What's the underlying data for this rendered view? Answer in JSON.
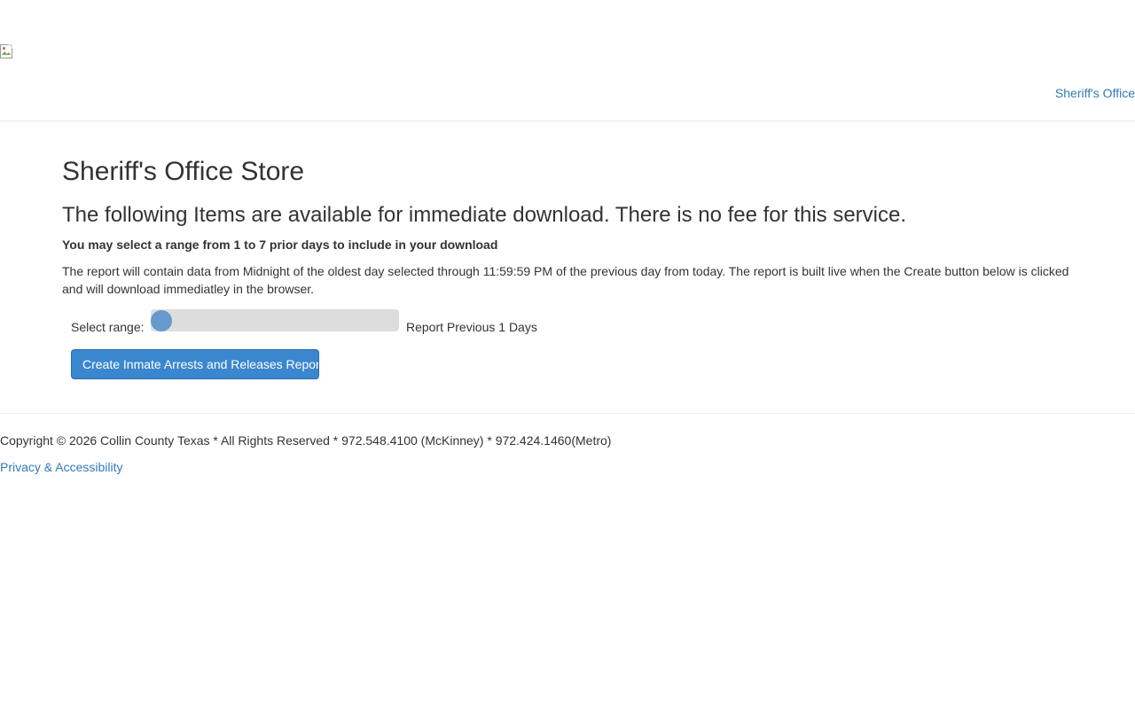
{
  "header": {
    "nav_link": "Sheriff's Office"
  },
  "main": {
    "title": "Sheriff's Office Store",
    "subtitle": "The following Items are available for immediate download. There is no fee for this service.",
    "range_note": "You may select a range from 1 to 7 prior days to include in your download",
    "description": "The report will contain data from Midnight of the oldest day selected through 11:59:59 PM of the previous day from today. The report is built live when the Create button below is clicked and will download immediatley in the browser.",
    "range": {
      "label": "Select range:",
      "min": 1,
      "max": 7,
      "value": 1,
      "value_text": "Report Previous 1 Days"
    },
    "create_button_label": "Create Inmate Arrests and Releases Report"
  },
  "footer": {
    "copyright": "Copyright © 2026 Collin County Texas * All Rights Reserved * 972.548.4100 (McKinney) * 972.424.1460(Metro)",
    "privacy_link": "Privacy & Accessibility"
  },
  "colors": {
    "link": "#337ab7",
    "button": "#3a87d0",
    "slider_thumb": "#6699cc",
    "slider_track": "#dddddd"
  },
  "icons": {
    "logo": "broken-image-icon"
  }
}
